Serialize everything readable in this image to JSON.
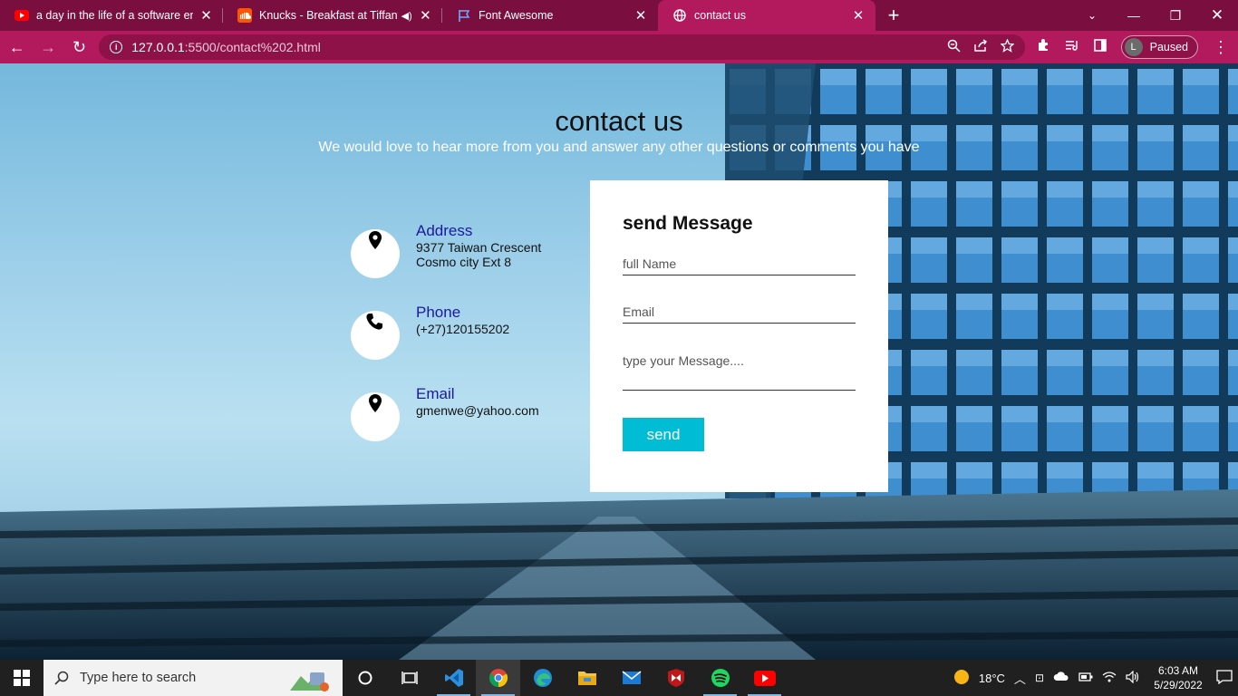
{
  "browser": {
    "tabs": [
      {
        "title": "a day in the life of a software eng",
        "icon": "youtube-icon"
      },
      {
        "title": "Knucks - Breakfast at Tiffany",
        "icon": "soundcloud-icon"
      },
      {
        "title": "Font Awesome",
        "icon": "flag-icon"
      },
      {
        "title": "contact us",
        "icon": "globe-icon"
      }
    ],
    "url_host": "127.0.0.1",
    "url_path": ":5500/contact%202.html",
    "profile_initial": "L",
    "profile_status": "Paused",
    "accent": "#b3195d"
  },
  "page": {
    "title": "contact us",
    "subtitle": "We would love to hear more from you and answer any other questions or comments you have",
    "info": [
      {
        "label": "Address",
        "lines": [
          "9377 Taiwan Crescent",
          "Cosmo city Ext 8"
        ],
        "icon": "location-pin-icon"
      },
      {
        "label": "Phone",
        "lines": [
          "(+27)120155202"
        ],
        "icon": "phone-icon"
      },
      {
        "label": "Email",
        "lines": [
          "gmenwe@yahoo.com"
        ],
        "icon": "location-pin-icon"
      }
    ],
    "form": {
      "heading": "send Message",
      "name_placeholder": "full Name",
      "email_placeholder": "Email",
      "message_placeholder": "type your Message....",
      "send_label": "send",
      "button_color": "#00bcd4"
    }
  },
  "taskbar": {
    "search_placeholder": "Type here to search",
    "weather": "18°C",
    "time": "6:03 AM",
    "date": "5/29/2022"
  }
}
